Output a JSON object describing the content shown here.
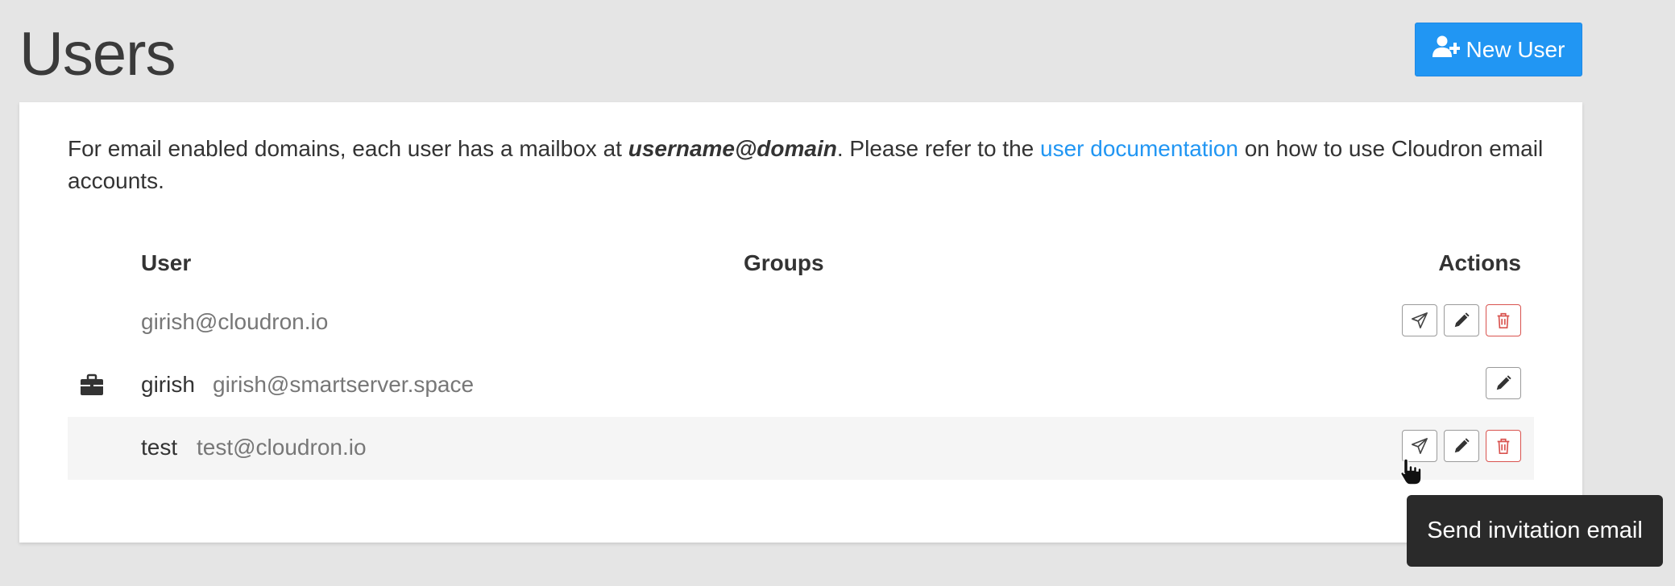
{
  "page": {
    "title": "Users",
    "new_user_label": "New User"
  },
  "info": {
    "text_before": "For email enabled domains, each user has a mailbox at ",
    "emphasis": "username@domain",
    "text_middle": ". Please refer to the ",
    "link_label": "user documentation",
    "text_after": " on how to use Cloudron email accounts."
  },
  "table": {
    "headers": {
      "user": "User",
      "groups": "Groups",
      "actions": "Actions"
    },
    "rows": [
      {
        "icon": "",
        "name": "",
        "email": "girish@cloudron.io",
        "actions": [
          "send-invite",
          "edit",
          "delete"
        ]
      },
      {
        "icon": "briefcase-icon",
        "name": "girish",
        "email": "girish@smartserver.space",
        "actions": [
          "edit"
        ]
      },
      {
        "icon": "",
        "name": "test",
        "email": "test@cloudron.io",
        "actions": [
          "send-invite",
          "edit",
          "delete"
        ]
      }
    ]
  },
  "tooltip": {
    "text": "Send invitation email"
  },
  "colors": {
    "primary": "#2196f3",
    "danger": "#d9534f",
    "background": "#e5e5e5",
    "tooltip_bg": "#2a2a2a"
  }
}
